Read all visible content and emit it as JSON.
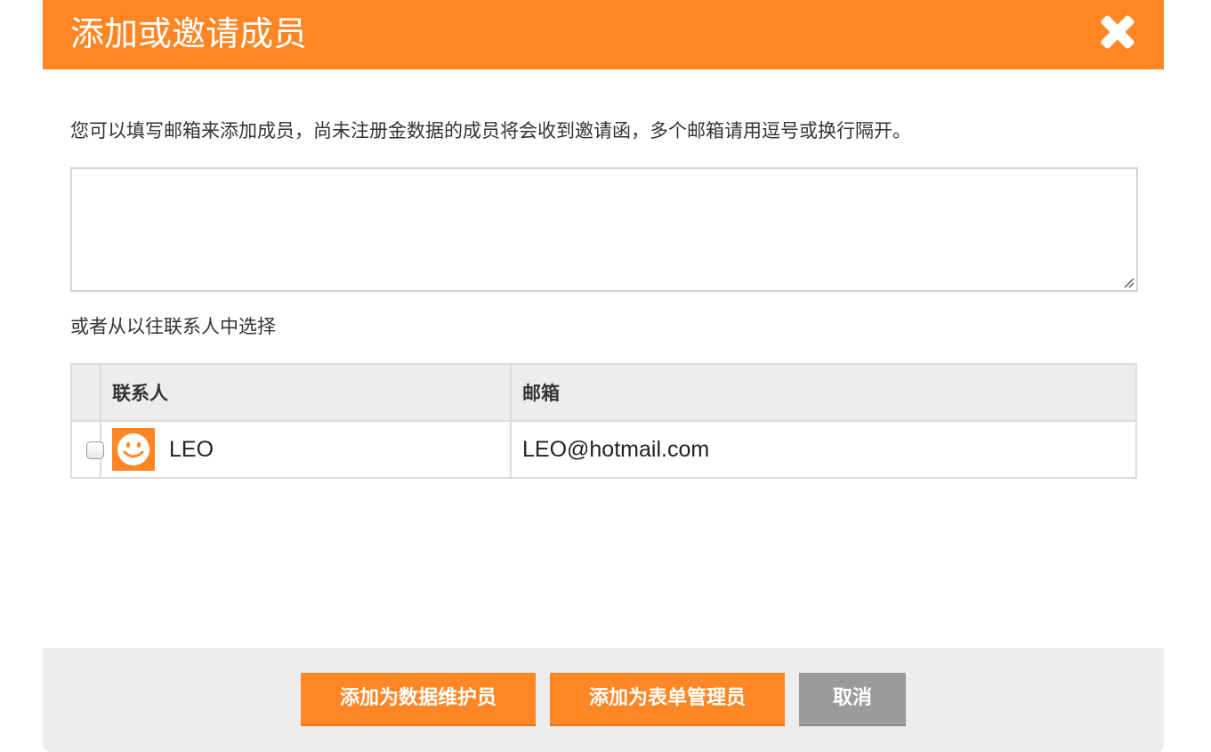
{
  "dialog": {
    "title": "添加或邀请成员",
    "close_icon": "close-x-icon",
    "accent_color": "#ff8625"
  },
  "invite": {
    "description": "您可以填写邮箱来添加成员，尚未注册金数据的成员将会收到邀请函，多个邮箱请用逗号或换行隔开。",
    "email_input_value": "",
    "or_label": "或者从以往联系人中选择"
  },
  "contacts_table": {
    "columns": [
      "",
      "联系人",
      "邮箱"
    ],
    "rows": [
      {
        "checked": false,
        "avatar_icon": "smiley-face-icon",
        "name": "LEO",
        "email": "LEO@hotmail.com"
      }
    ]
  },
  "footer": {
    "add_maintainer_label": "添加为数据维护员",
    "add_form_admin_label": "添加为表单管理员",
    "cancel_label": "取消"
  }
}
